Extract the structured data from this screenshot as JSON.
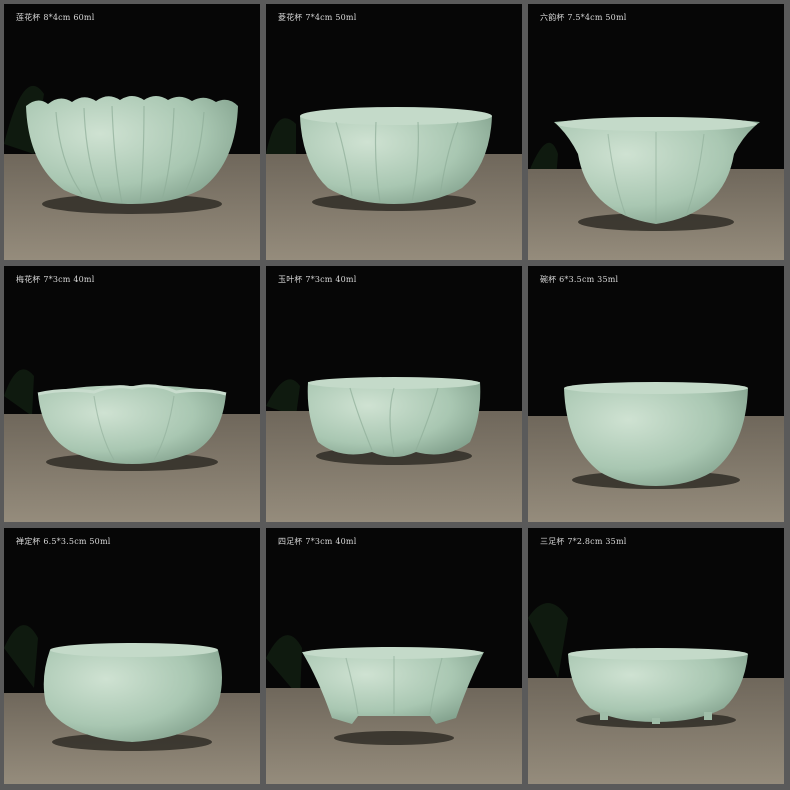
{
  "cups": [
    {
      "label": "莲花杯 8*4cm 60ml",
      "shape": "lotus"
    },
    {
      "label": "菱花杯 7*4cm 50ml",
      "shape": "water-caltrop"
    },
    {
      "label": "六韵杯 7.5*4cm 50ml",
      "shape": "six-rhyme"
    },
    {
      "label": "梅花杯 7*3cm 40ml",
      "shape": "plum-blossom"
    },
    {
      "label": "玉叶杯 7*3cm 40ml",
      "shape": "jade-leaf"
    },
    {
      "label": "碗杯 6*3.5cm 35ml",
      "shape": "bowl"
    },
    {
      "label": "禅定杯 6.5*3.5cm 50ml",
      "shape": "zen"
    },
    {
      "label": "四足杯 7*3cm 40ml",
      "shape": "four-foot"
    },
    {
      "label": "三足杯 7*2.8cm 35ml",
      "shape": "three-foot"
    }
  ],
  "colors": {
    "background": "#050505",
    "tablecloth": "#8a8274",
    "celadon": "#a9c7b2",
    "border": "#5a5a5a"
  }
}
